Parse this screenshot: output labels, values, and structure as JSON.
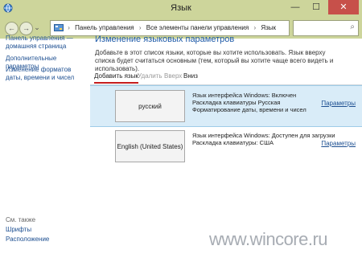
{
  "window": {
    "title": "Язык",
    "minimize": "—",
    "maximize": "☐",
    "close": "✕"
  },
  "nav": {
    "back": "←",
    "forward": "→",
    "up": "↑",
    "recent": "⌄",
    "breadcrumbs": [
      "Панель управления",
      "Все элементы панели управления",
      "Язык"
    ],
    "separator": "›",
    "dropdown": "⌄",
    "refresh": "↻",
    "search_placeholder": "",
    "search_icon": "⌕"
  },
  "sidebar": {
    "home": "Панель управления — домашняя страница",
    "advanced": "Дополнительные параметры",
    "formats": "Изменение форматов даты, времени и чисел",
    "see_also": "См. также",
    "fonts": "Шрифты",
    "location": "Расположение"
  },
  "main": {
    "heading": "Изменение языковых параметров",
    "description": "Добавьте в этот список языки, которые вы хотите использовать. Язык вверху списка будет считаться основным (тем, который вы хотите чаще всего видеть и использовать).",
    "toolbar": {
      "add": "Добавить язык",
      "remove": "Удалить",
      "up": "Вверх",
      "down": "Вниз"
    },
    "languages": [
      {
        "name": "русский",
        "info": [
          "Язык интерфейса Windows: Включен",
          "Раскладка клавиатуры Русская",
          "Форматирование даты, времени и чисел"
        ],
        "options": "Параметры"
      },
      {
        "name": "English (United States)",
        "info": [
          "Язык интерфейса Windows: Доступен для загрузки",
          "Раскладка клавиатуры: США"
        ],
        "options": "Параметры"
      }
    ]
  },
  "watermark": "www.wincore.ru",
  "colors": {
    "titlebar": "#cdd59b",
    "accent_link": "#1d4f91",
    "selected_row": "#d9ecf8",
    "close": "#c7504a"
  }
}
